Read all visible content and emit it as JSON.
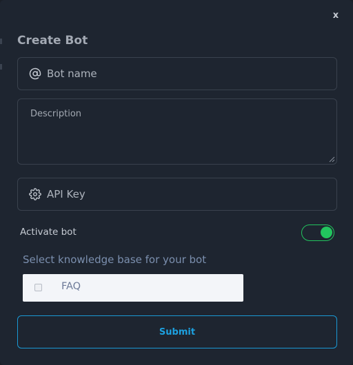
{
  "modal": {
    "title": "Create Bot",
    "close_label": "x"
  },
  "fields": {
    "bot_name": {
      "placeholder": "Bot name",
      "value": "",
      "icon": "at-icon"
    },
    "description": {
      "placeholder": "Description",
      "value": ""
    },
    "api_key": {
      "placeholder": "API Key",
      "value": "",
      "icon": "gear-icon"
    }
  },
  "activate": {
    "label": "Activate bot",
    "enabled": true
  },
  "knowledge_base": {
    "label": "Select knowledge base for your bot",
    "options": [
      {
        "label": "FAQ",
        "checked": false
      }
    ]
  },
  "submit": {
    "label": "Submit"
  },
  "colors": {
    "background": "#1e2530",
    "border": "#3a424e",
    "toggle_active": "#22c55e",
    "accent": "#1da1e0",
    "kb_label": "#7b8fae"
  }
}
